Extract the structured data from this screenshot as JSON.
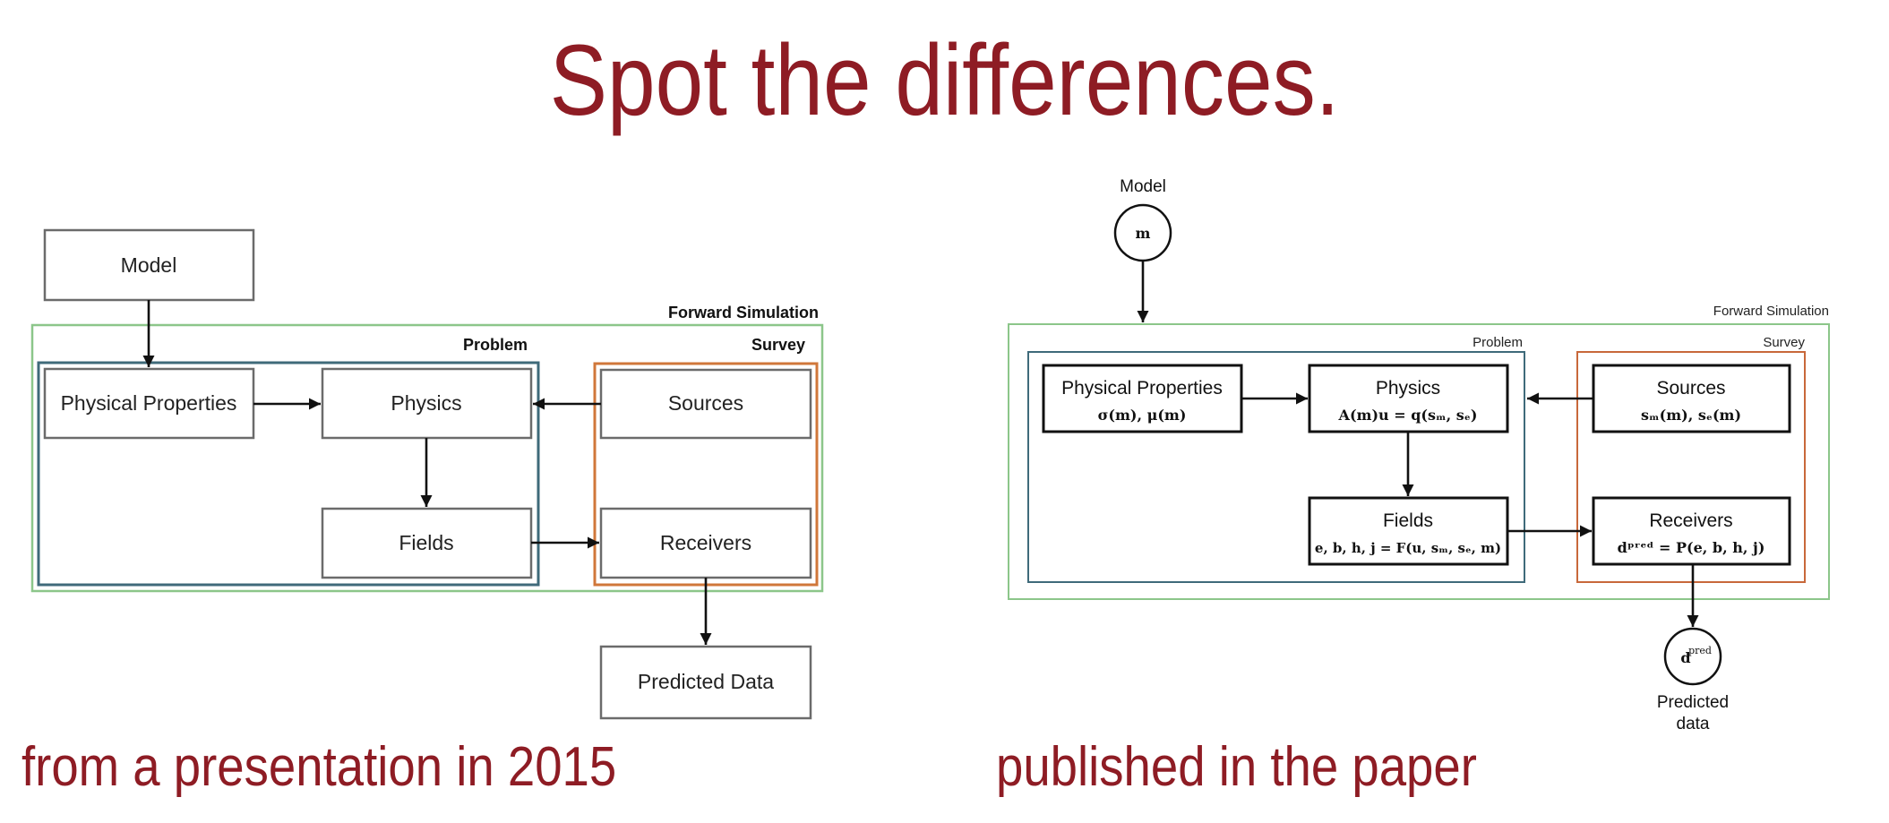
{
  "title": "Spot the differences.",
  "colors": {
    "accent": "#8e1c24",
    "forward_simulation": "#8cc68a",
    "problem": "#3f6a7a",
    "survey": "#d0773a"
  },
  "left_panel": {
    "caption": "from a presentation in 2015",
    "groups": {
      "forward_simulation": "Forward Simulation",
      "problem": "Problem",
      "survey": "Survey"
    },
    "nodes": {
      "model": "Model",
      "physical_properties": "Physical Properties",
      "physics": "Physics",
      "fields": "Fields",
      "sources": "Sources",
      "receivers": "Receivers",
      "predicted_data": "Predicted Data"
    }
  },
  "right_panel": {
    "caption": "published in the paper",
    "groups": {
      "forward_simulation": "Forward Simulation",
      "problem": "Problem",
      "survey": "Survey"
    },
    "model": {
      "label": "Model",
      "symbol": "m"
    },
    "predicted": {
      "label_line1": "Predicted",
      "label_line2": "data",
      "symbol": "d",
      "symbol_sup": "pred"
    },
    "nodes": {
      "physical_properties": {
        "title": "Physical Properties",
        "equation": "σ(m), μ(m)"
      },
      "physics": {
        "title": "Physics",
        "equation": "A(m)u = q(sₘ, sₑ)"
      },
      "fields": {
        "title": "Fields",
        "equation": "e, b, h, j = F(u, sₘ, sₑ, m)"
      },
      "sources": {
        "title": "Sources",
        "equation": "sₘ(m), sₑ(m)"
      },
      "receivers": {
        "title": "Receivers",
        "equation": "dᵖʳᵉᵈ = P(e, b, h, j)"
      }
    }
  }
}
